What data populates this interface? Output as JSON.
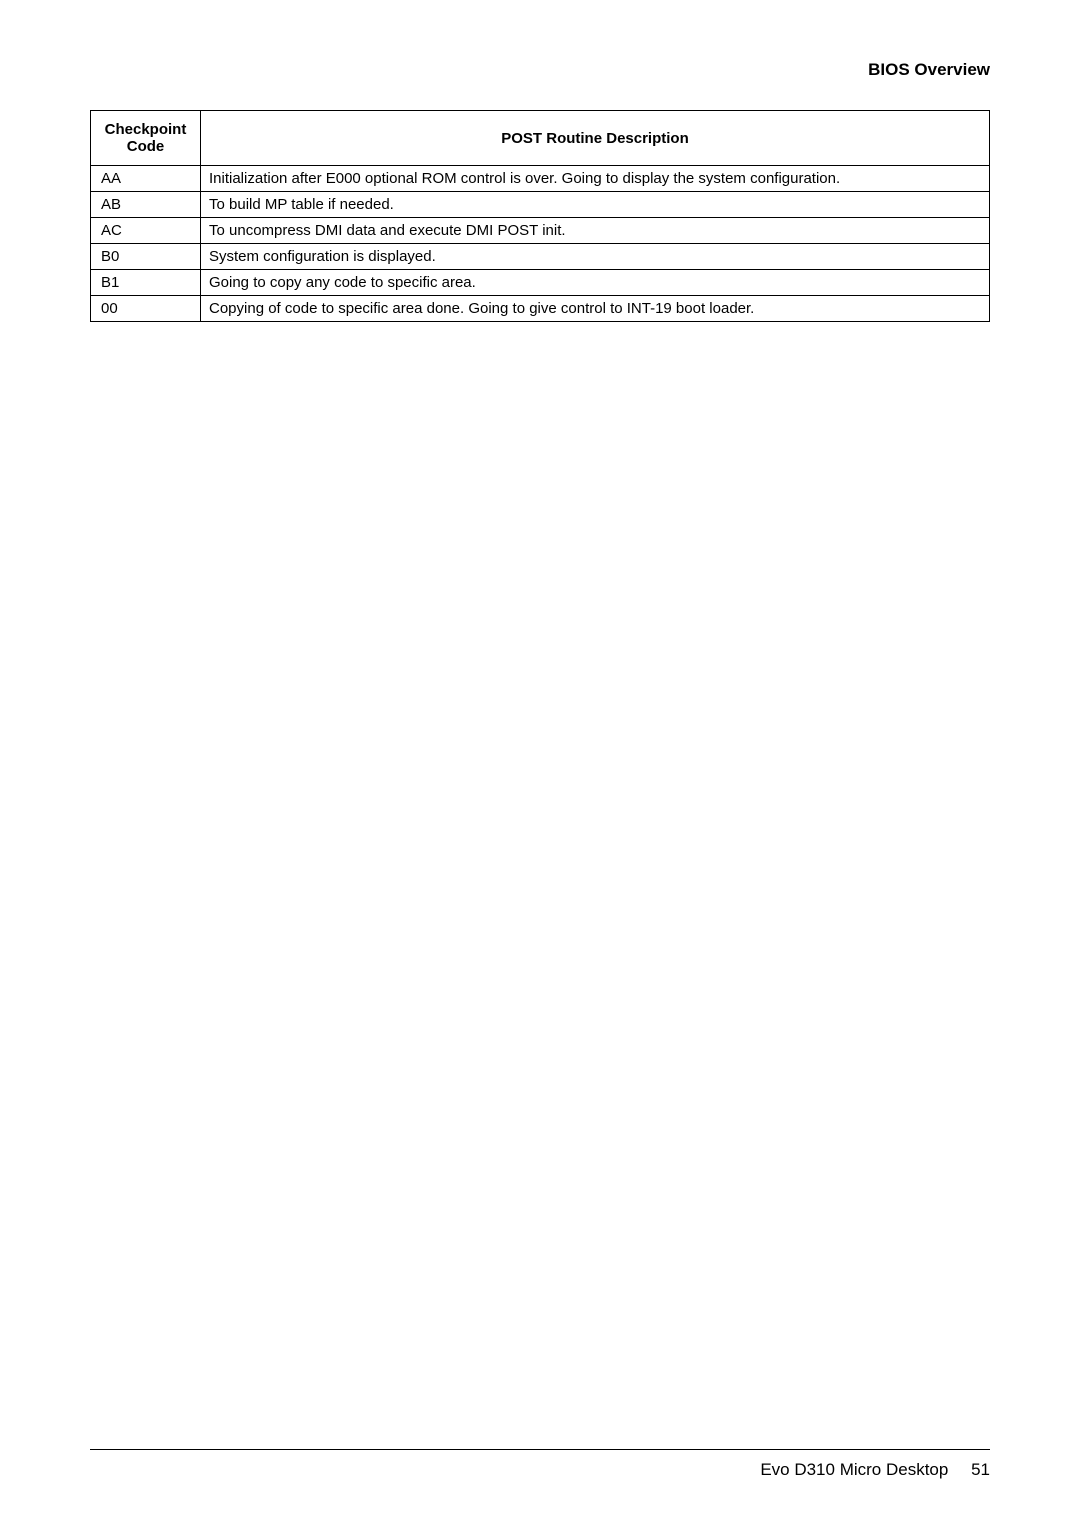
{
  "header": {
    "section_title": "BIOS Overview"
  },
  "table": {
    "header_code": "Checkpoint Code",
    "header_desc": "POST Routine Description",
    "rows": [
      {
        "code": "AA",
        "desc": "Initialization after E000 optional ROM control is over. Going to display the system configuration."
      },
      {
        "code": "AB",
        "desc": "To build MP table if needed."
      },
      {
        "code": "AC",
        "desc": "To uncompress DMI data and execute DMI POST init."
      },
      {
        "code": "B0",
        "desc": "System configuration is displayed."
      },
      {
        "code": "B1",
        "desc": "Going to copy any code to specific area."
      },
      {
        "code": "00",
        "desc": "Copying of code to specific area done. Going to give control to INT-19 boot loader."
      }
    ]
  },
  "footer": {
    "product": "Evo D310 Micro Desktop",
    "page": "51"
  }
}
